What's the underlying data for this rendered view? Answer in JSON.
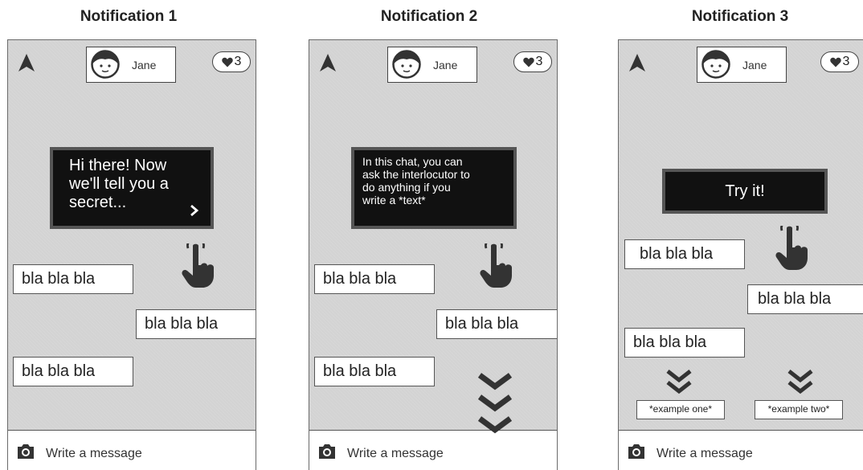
{
  "screens": [
    {
      "title": "Notification 1",
      "profile_name": "Jane",
      "likes": "3",
      "tip_lines": [
        "Hi there! Now",
        "we'll tell you a",
        "secret..."
      ],
      "bubbles": [
        "bla bla bla",
        "bla bla bla",
        "bla bla bla"
      ],
      "input_placeholder": "Write a message"
    },
    {
      "title": "Notification 2",
      "profile_name": "Jane",
      "likes": "3",
      "tip_lines": [
        "In this chat, you can",
        "ask the interlocutor to",
        "do anything if you",
        "write a *text*"
      ],
      "bubbles": [
        "bla bla bla",
        "bla bla bla",
        "bla bla bla"
      ],
      "input_placeholder": "Write a message"
    },
    {
      "title": "Notification 3",
      "profile_name": "Jane",
      "likes": "3",
      "tip_lines": [
        "Try it!"
      ],
      "bubbles": [
        "bla bla bla",
        "bla bla bla",
        "bla bla bla"
      ],
      "examples": [
        "*example one*",
        "*example two*"
      ],
      "input_placeholder": "Write a message"
    }
  ],
  "colors": {
    "screen_bg": "#d3d3d3",
    "tooltip_bg": "#111111",
    "tooltip_border": "#555555",
    "bubble_bg": "#ffffff",
    "icon": "#333333"
  },
  "icons": [
    "navigation-arrow-icon",
    "face-avatar-icon",
    "heart-icon",
    "chevron-right-icon",
    "pointing-hand-icon",
    "chevron-double-down-icon",
    "camera-icon"
  ]
}
